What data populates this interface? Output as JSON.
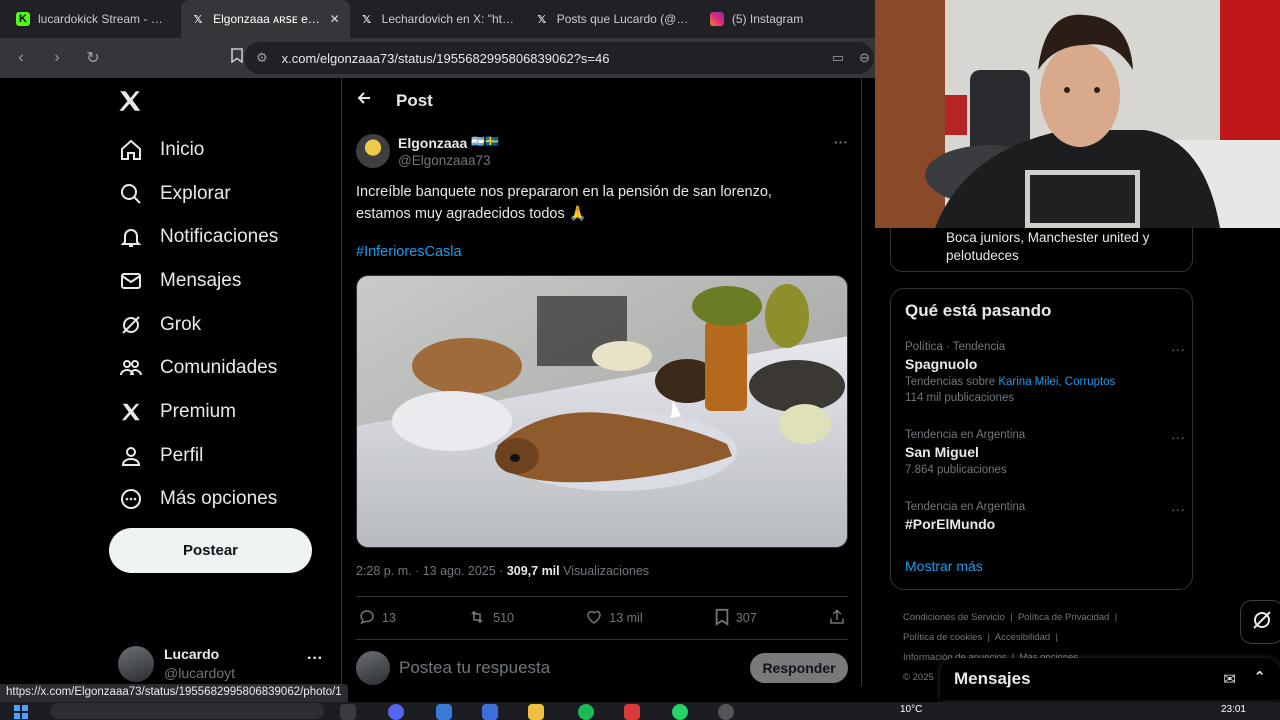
{
  "browser": {
    "tabs": [
      {
        "title": "lucardokick Stream - Watch",
        "icon": "kick-icon",
        "color": "#53fc18",
        "active": false
      },
      {
        "title": "Elgonzaaa ᴀʀꜱᴇ en X: \"Incre",
        "icon": "x-icon",
        "color": "#ffffff",
        "active": true
      },
      {
        "title": "Lechardovich en X: \"https:/",
        "icon": "x-icon",
        "color": "#ffffff",
        "active": false
      },
      {
        "title": "Posts que Lucardo (@lucar",
        "icon": "x-icon",
        "color": "#ffffff",
        "active": false
      },
      {
        "title": "(5) Instagram",
        "icon": "instagram-icon",
        "color": "#e1306c",
        "active": false
      }
    ],
    "url": "x.com/elgonzaaa73/status/1955682995806839062?s=46",
    "status_url": "https://x.com/Elgonzaaa73/status/1955682995806839062/photo/1"
  },
  "sidebar": {
    "items": [
      {
        "label": "Inicio",
        "icon": "home-icon"
      },
      {
        "label": "Explorar",
        "icon": "search-icon"
      },
      {
        "label": "Notificaciones",
        "icon": "bell-icon"
      },
      {
        "label": "Mensajes",
        "icon": "mail-icon"
      },
      {
        "label": "Grok",
        "icon": "grok-icon"
      },
      {
        "label": "Comunidades",
        "icon": "communities-icon"
      },
      {
        "label": "Premium",
        "icon": "x-premium-icon"
      },
      {
        "label": "Perfil",
        "icon": "profile-icon"
      },
      {
        "label": "Más opciones",
        "icon": "more-circle-icon"
      }
    ],
    "post_button": "Postear",
    "account": {
      "name": "Lucardo",
      "handle": "@lucardoyt"
    }
  },
  "post": {
    "header": "Post",
    "author_name": "Elgonzaaa",
    "author_flags": "🇦🇷🇸🇪",
    "author_handle": "@Elgonzaaa73",
    "text_line1": "Increíble banquete nos prepararon en la pensión de san lorenzo,",
    "text_line2": "estamos muy agradecidos todos 🙏",
    "hashtag": "#InferioresCasla",
    "time": "2:28 p. m. · 13 ago. 2025 ·",
    "views_count": "309,7 mil",
    "views_label": "Visualizaciones",
    "replies": "13",
    "reposts": "510",
    "likes": "13 mil",
    "bookmarks": "307",
    "reply_placeholder": "Postea tu respuesta",
    "reply_button": "Responder"
  },
  "right": {
    "top_card_text_line1": "Boca juniors, Manchester united y",
    "top_card_text_line2": "pelotudeces",
    "trends_title": "Qué está pasando",
    "trends": [
      {
        "context": "Política · Tendencia",
        "name": "Spagnuolo",
        "sub_prefix": "Tendencias sobre ",
        "sub_links": "Karina Milei, Corruptos",
        "count": "114 mil publicaciones"
      },
      {
        "context": "Tendencia en Argentina",
        "name": "San Miguel",
        "sub_prefix": "",
        "sub_links": "",
        "count": "7.864 publicaciones"
      },
      {
        "context": "Tendencia en Argentina",
        "name": "#PorElMundo",
        "sub_prefix": "",
        "sub_links": "",
        "count": ""
      }
    ],
    "show_more": "Mostrar más",
    "footer_links": [
      "Condiciones de Servicio",
      "Política de Privacidad",
      "Política de cookies",
      "Accesibilidad",
      "Información de anuncios",
      "Más opciones"
    ],
    "footer_copyright": "© 2025",
    "messages_drawer": "Mensajes"
  },
  "taskbar": {
    "time": "23:01",
    "weather": "10°C"
  }
}
